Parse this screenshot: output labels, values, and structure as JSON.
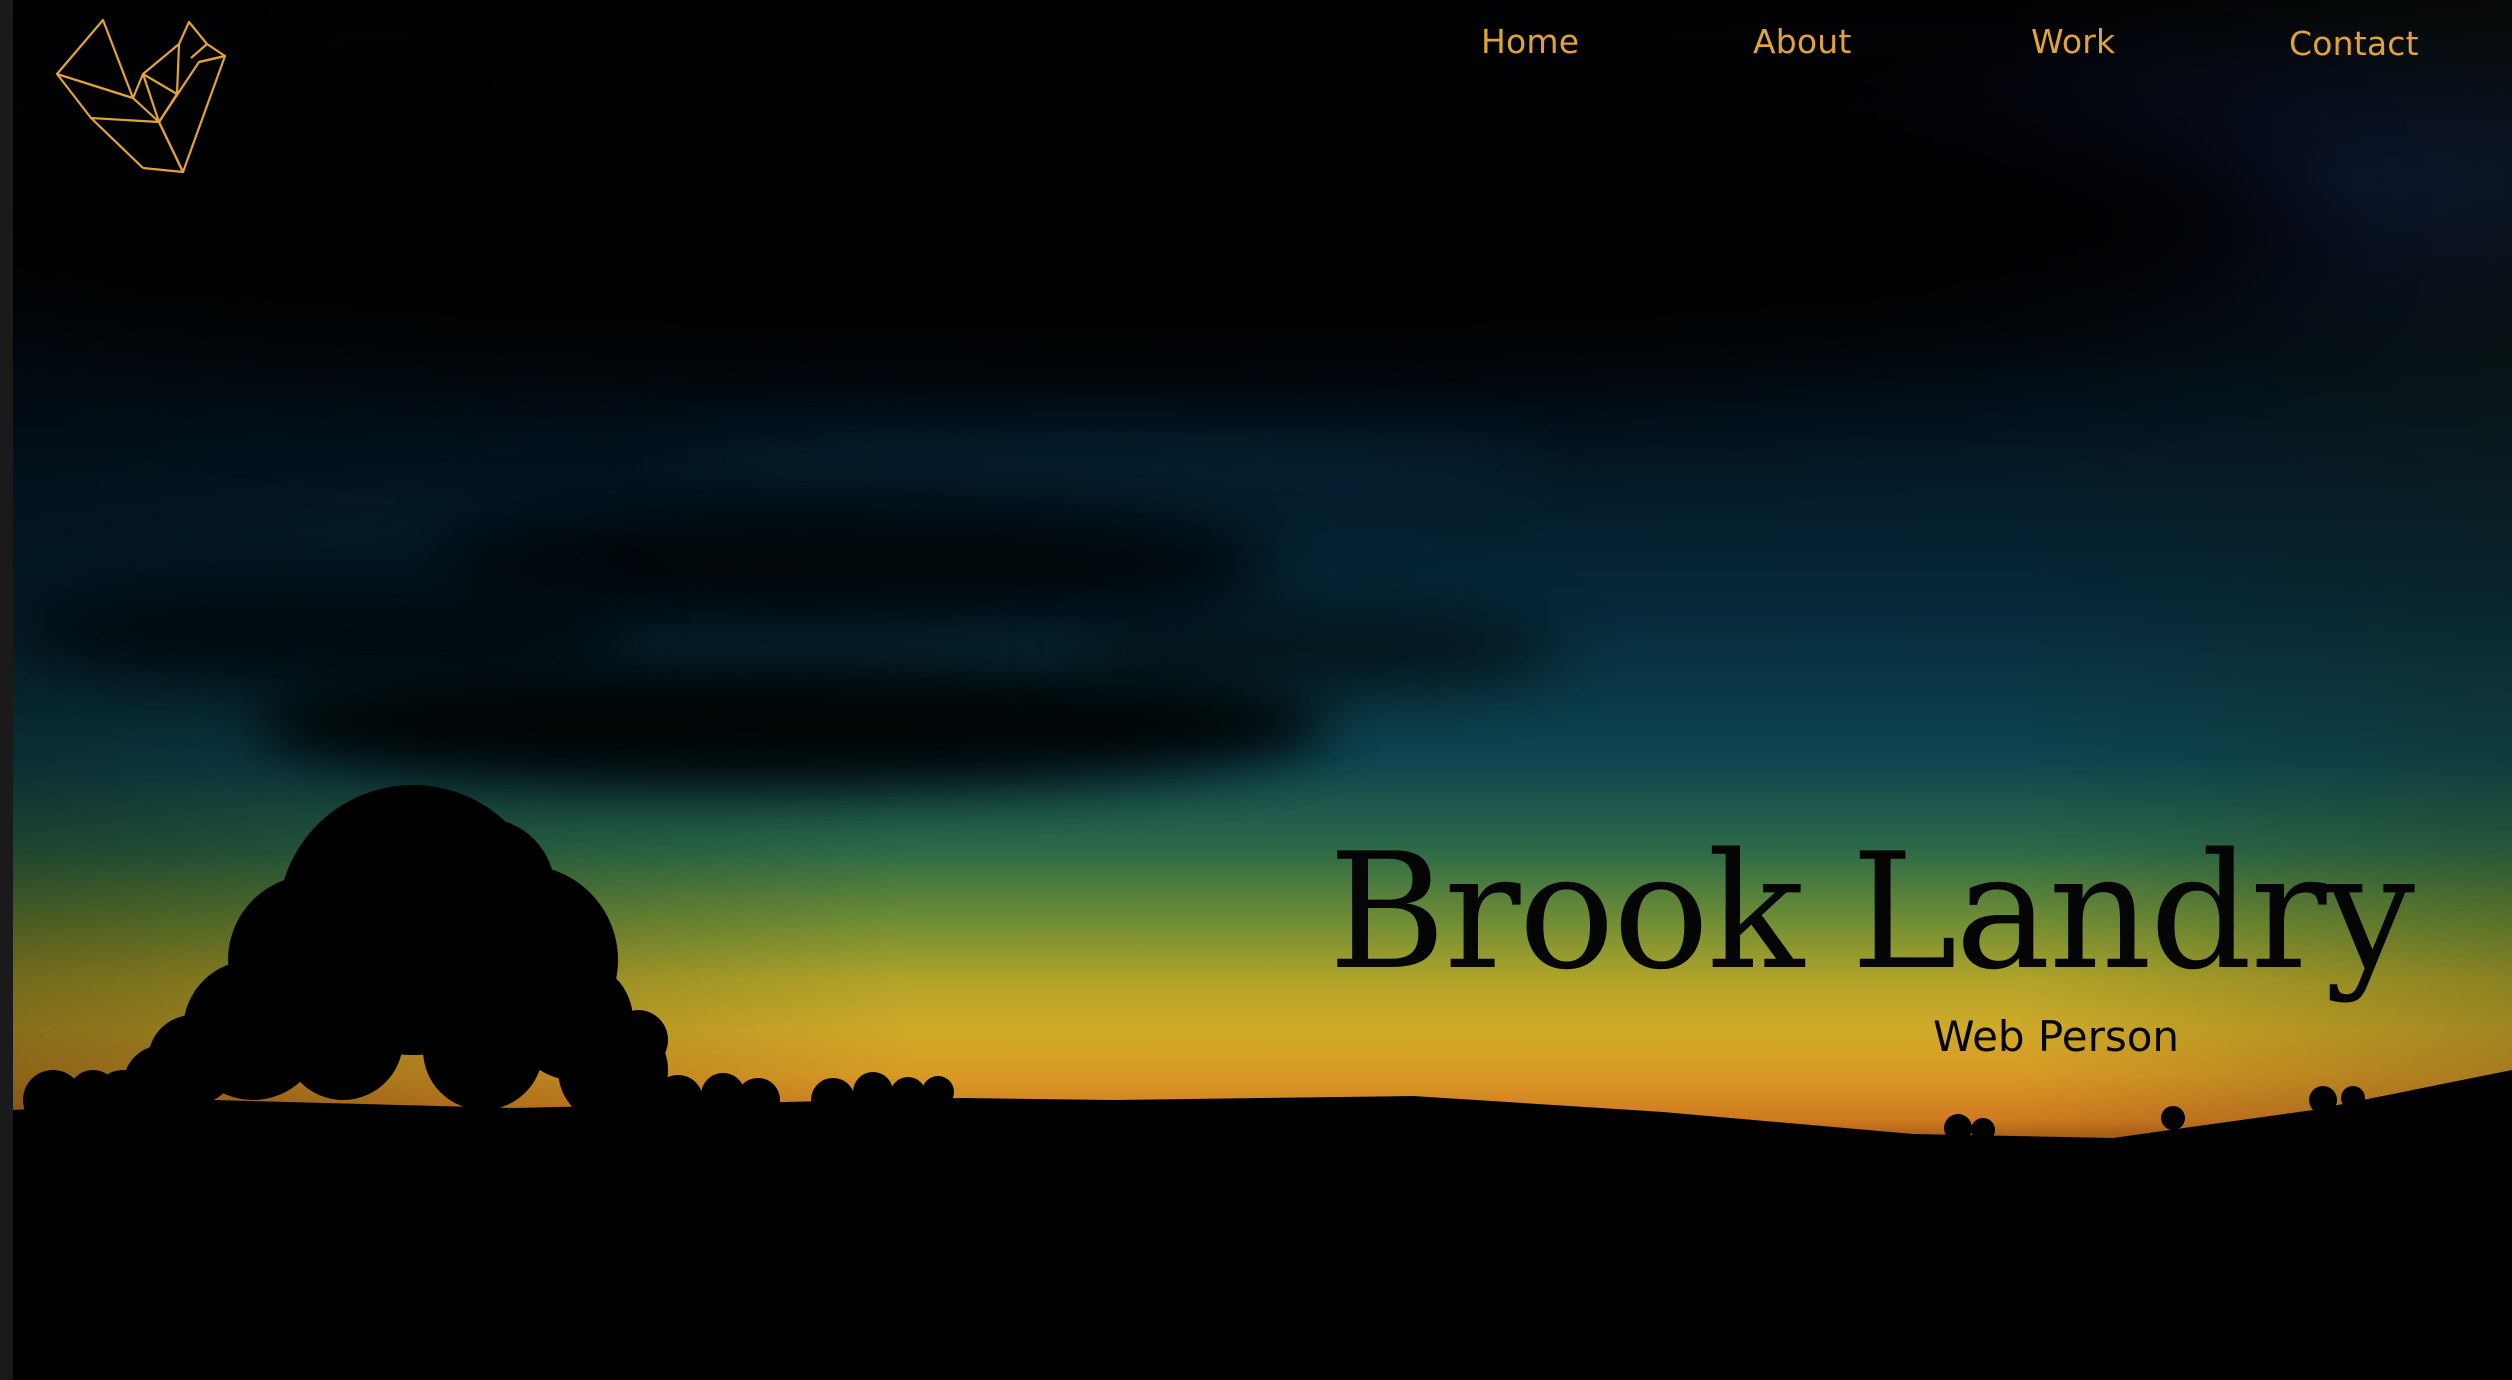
{
  "nav": {
    "items": [
      {
        "label": "Home"
      },
      {
        "label": "About"
      },
      {
        "label": "Work"
      },
      {
        "label": "Contact"
      }
    ]
  },
  "hero": {
    "title": "Brook Landry",
    "subtitle": "Web Person"
  },
  "logo": {
    "icon": "origami-crane-icon"
  },
  "colors": {
    "accent": "#e2a23a",
    "text_dark": "#050505",
    "background": "#000000",
    "horizon_gold": "#d0aa28",
    "sky_teal": "#0e4550"
  }
}
